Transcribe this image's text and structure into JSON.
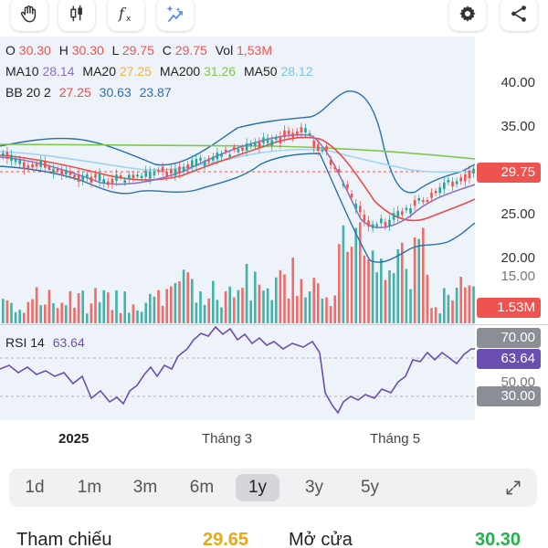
{
  "toolbar": {
    "icons": [
      "hand-icon",
      "candlestick-icon",
      "fx-icon",
      "magic-icon",
      "gear-icon",
      "share-icon"
    ]
  },
  "legend": {
    "ohlc": {
      "o_label": "O",
      "o": "30.30",
      "h_label": "H",
      "h": "30.30",
      "l_label": "L",
      "l": "29.75",
      "c_label": "C",
      "c": "29.75",
      "vol_label": "Vol",
      "vol": "1,53M"
    },
    "ma": {
      "ma10_label": "MA10",
      "ma10": "28.14",
      "ma20_label": "MA20",
      "ma20": "27.25",
      "ma200_label": "MA200",
      "ma200": "31.26",
      "ma50_label": "MA50",
      "ma50": "28.12"
    },
    "bb": {
      "label": "BB 20 2",
      "mid": "27.25",
      "upper": "30.63",
      "lower": "23.87"
    },
    "rsi": {
      "label": "RSI 14",
      "value": "63.64"
    }
  },
  "y_axis": {
    "ticks": [
      "40.00",
      "35.00",
      "25.00",
      "20.00",
      "15.00"
    ],
    "price_tag": "29.75",
    "vol_tag": "1.53M",
    "rsi_ticks": [
      "70.00",
      "30.00",
      "50.00"
    ],
    "rsi_tag": "63.64"
  },
  "x_axis": {
    "labels": [
      "2025",
      "Tháng 3",
      "Tháng 5"
    ]
  },
  "timeframes": {
    "items": [
      "1d",
      "1m",
      "3m",
      "6m",
      "1y",
      "3y",
      "5y"
    ],
    "active": "1y"
  },
  "quote": {
    "ref_label": "Tham chiếu",
    "ref_value": "29.65",
    "open_label": "Mở cửa",
    "open_value": "30.30"
  },
  "colors": {
    "up": "#26a69a",
    "down": "#ef5350",
    "ma10": "#8e6fc7",
    "ma20": "#f2b544",
    "ma200": "#7cc84f",
    "ma50": "#9fd3f2",
    "bb_mid": "#ea4b4b",
    "bb_band": "#2a6fa8",
    "rsi": "#6a4fb0",
    "ref": "#e6a817",
    "open": "#22b14c"
  }
}
